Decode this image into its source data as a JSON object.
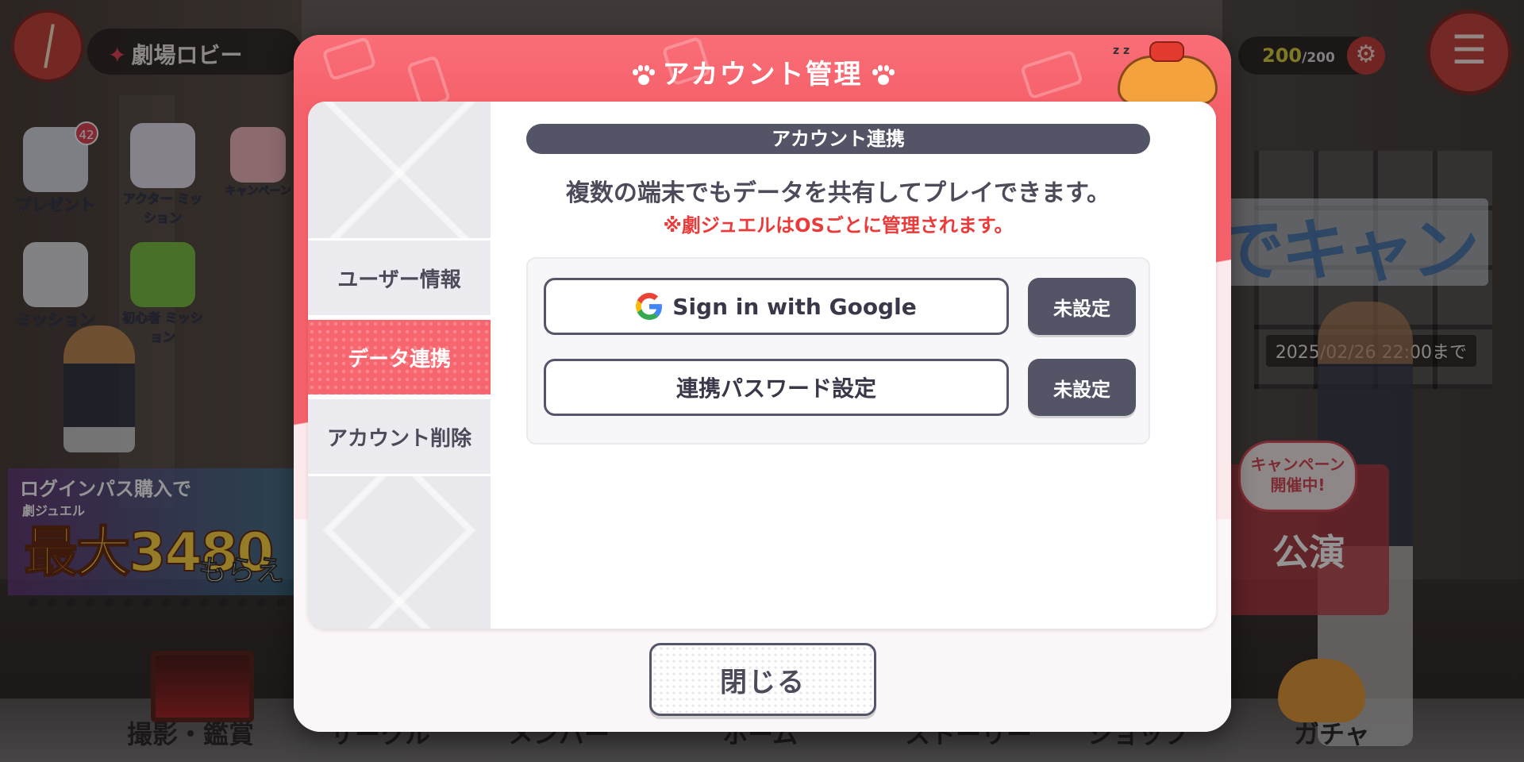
{
  "background": {
    "location": "劇場ロビー",
    "stamina_current": "200",
    "stamina_max": "/200",
    "side_icons": [
      "プレゼント",
      "アクター ミッション",
      "ミッション",
      "初心者 ミッション",
      "キャンペーン"
    ],
    "present_badge": "42",
    "promo_line1": "ログインパス購入で",
    "promo_line2": "劇ジュエル",
    "promo_big": "最大3480",
    "promo_more": "もらえ",
    "right_banner": "えでキャン",
    "deadline": "2025/02/26 22:00まで",
    "campaign_bubble": "キャンペーン 開催中!",
    "campaign_title": "公演",
    "bottom_nav": [
      "撮影・鑑賞",
      "サークル",
      "メンバー",
      "ホーム",
      "ストーリー",
      "ショップ",
      "ガチャ"
    ]
  },
  "modal": {
    "title": "アカウント管理",
    "tabs": [
      {
        "label": "ユーザー情報",
        "active": false
      },
      {
        "label": "データ連携",
        "active": true
      },
      {
        "label": "アカウント削除",
        "active": false
      }
    ],
    "section_title": "アカウント連携",
    "description": "複数の端末でもデータを共有してプレイできます。",
    "note": "※劇ジュエルはOSごとに管理されます。",
    "links": [
      {
        "label": "Sign in with Google",
        "icon": "google-icon",
        "status": "未設定"
      },
      {
        "label": "連携パスワード設定",
        "icon": "",
        "status": "未設定"
      }
    ],
    "close_label": "閉じる"
  },
  "colors": {
    "accent_pink": "#f5616b",
    "dark_slate": "#545467",
    "note_red": "#ea3a3a"
  }
}
